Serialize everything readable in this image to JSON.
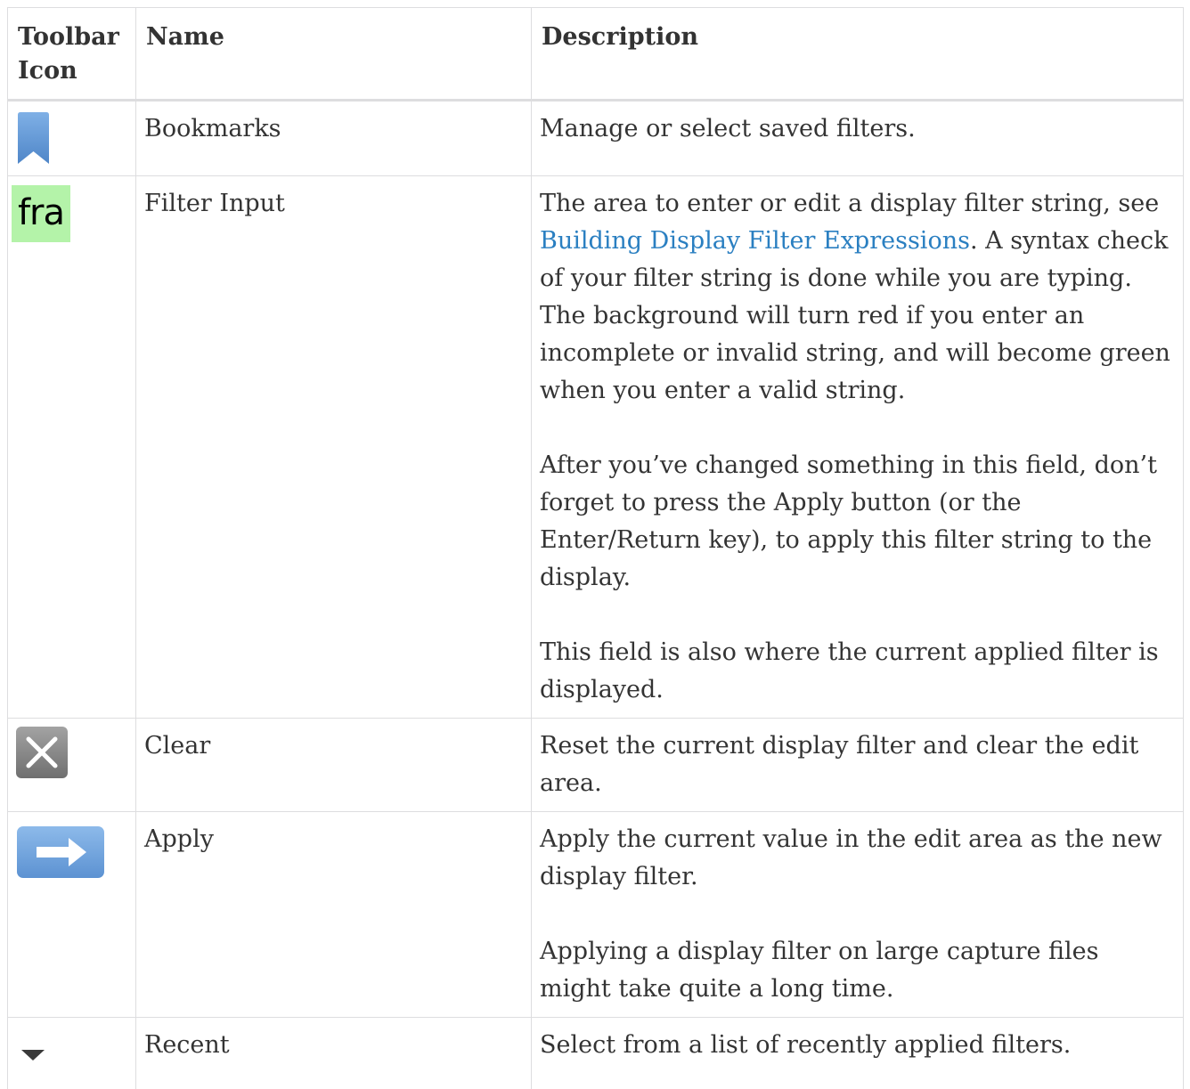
{
  "table": {
    "headers": {
      "icon": "Toolbar Icon",
      "name": "Name",
      "description": "Description"
    },
    "rows": [
      {
        "icon": "bookmark-icon",
        "name": "Bookmarks",
        "description": [
          "Manage or select saved filters."
        ]
      },
      {
        "icon": "filter-input-icon",
        "icon_text": "fra",
        "name": "Filter Input",
        "description_link": "Building Display Filter Expressions",
        "description_before": "The area to enter or edit a display filter string, see ",
        "description_after": ". A syntax check of your filter string is done while you are typing. The background will turn red if you enter an incomplete or invalid string, and will become green when you enter a valid string.",
        "description": [
          "After you’ve changed something in this field, don’t forget to press the Apply button (or the Enter/Return key), to apply this filter string to the display.",
          "This field is also where the current applied filter is displayed."
        ]
      },
      {
        "icon": "clear-icon",
        "name": "Clear",
        "description": [
          "Reset the current display filter and clear the edit area."
        ]
      },
      {
        "icon": "apply-arrow-icon",
        "name": "Apply",
        "description": [
          "Apply the current value in the edit area as the new display filter.",
          "Applying a display filter on large capture files might take quite a long time."
        ]
      },
      {
        "icon": "recent-dropdown-icon",
        "name": "Recent",
        "description": [
          "Select from a list of recently applied filters."
        ]
      }
    ]
  },
  "colors": {
    "link": "#2a7fc1",
    "border": "#dddddf",
    "filter_valid_bg": "#b4f3a9",
    "bookmark_blue": "#6a9fd8",
    "apply_blue": "#6ea2dc",
    "clear_gray": "#8a8a8a"
  }
}
